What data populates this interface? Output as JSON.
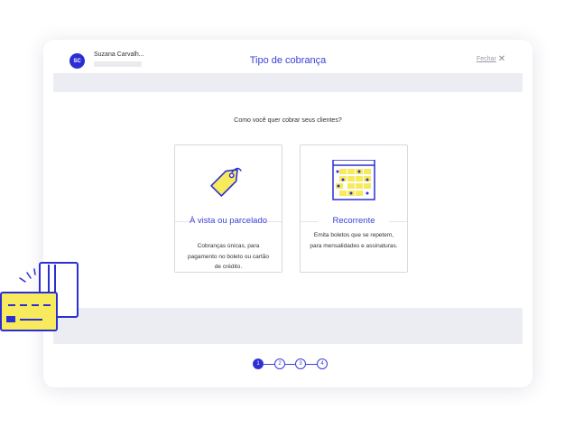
{
  "header": {
    "avatar_initials": "SC",
    "user_name": "Suzana Carvalh...",
    "title": "Tipo de cobrança",
    "close_label": "Fechar",
    "close_icon": "close-icon"
  },
  "main": {
    "question": "Como você quer cobrar seus clientes?",
    "options": [
      {
        "icon": "price-tag-icon",
        "title": "À vista ou parcelado",
        "description": "Cobranças únicas, para pagamento no boleto ou cartão de crédito."
      },
      {
        "icon": "calendar-icon",
        "title": "Recorrente",
        "description": "Emita boletos que se repetem, para mensalidades e assinaturas."
      }
    ]
  },
  "stepper": {
    "steps": [
      "1",
      "2",
      "3",
      "4"
    ],
    "current": 1
  },
  "colors": {
    "accent": "#2b2fd3",
    "accent_text": "#3a3fd6",
    "highlight": "#f7ea5c",
    "band": "#ebedf3"
  },
  "decoration": {
    "icon": "credit-cards-icon"
  }
}
